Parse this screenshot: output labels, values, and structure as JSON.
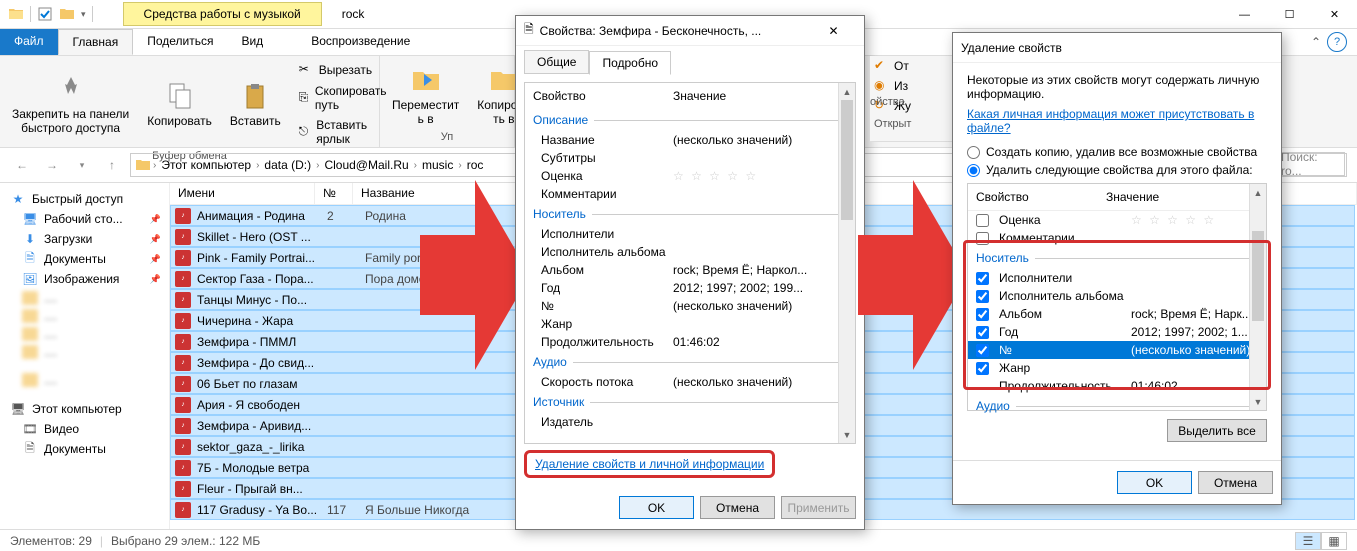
{
  "titlebar": {
    "music_tools": "Средства работы с музыкой",
    "folder": "rock"
  },
  "ribbon_tabs": {
    "file": "Файл",
    "home": "Главная",
    "share": "Поделиться",
    "view": "Вид",
    "playback": "Воспроизведение"
  },
  "ribbon": {
    "pin": "Закрепить на панели\nбыстрого доступа",
    "copy": "Копировать",
    "paste": "Вставить",
    "cut": "Вырезать",
    "copy_path": "Скопировать путь",
    "paste_shortcut": "Вставить ярлык",
    "clipboard_group": "Буфер обмена",
    "move_to": "Переместит\nь в",
    "copy_to": "Копирова\nть в",
    "org_group": "Уп",
    "open_group": "Открыт"
  },
  "breadcrumbs": [
    "Этот компьютер",
    "data (D:)",
    "Cloud@Mail.Ru",
    "music",
    "roc"
  ],
  "search_placeholder": "Поиск: ro...",
  "sidebar": {
    "quick": "Быстрый доступ",
    "desktop": "Рабочий сто...",
    "downloads": "Загрузки",
    "documents": "Документы",
    "pictures": "Изображения",
    "thispc": "Этот компьютер",
    "videos": "Видео",
    "documents2": "Документы"
  },
  "columns": {
    "name": "Имени",
    "num": "№",
    "title": "Название"
  },
  "files": [
    {
      "name": "Анимация - Родина",
      "num": "2",
      "title": "Родина"
    },
    {
      "name": "Skillet - Hero (OST ...",
      "num": "",
      "title": ""
    },
    {
      "name": "Pink - Family Portrai...",
      "num": "",
      "title": "Family portrait"
    },
    {
      "name": "Сектор Газа - Пора...",
      "num": "",
      "title": "Пора домой"
    },
    {
      "name": "Танцы Минус - По...",
      "num": "",
      "title": ""
    },
    {
      "name": "Чичерина - Жара",
      "num": "",
      "title": ""
    },
    {
      "name": "Земфира - ПММЛ",
      "num": "",
      "title": ""
    },
    {
      "name": "Земфира - До свид...",
      "num": "",
      "title": ""
    },
    {
      "name": "06 Бьет по глазам",
      "num": "",
      "title": ""
    },
    {
      "name": "Ария - Я свободен",
      "num": "",
      "title": ""
    },
    {
      "name": "Земфира - Аривид...",
      "num": "",
      "title": ""
    },
    {
      "name": "sektor_gaza_-_lirika",
      "num": "",
      "title": ""
    },
    {
      "name": "7Б - Молодые ветра",
      "num": "",
      "title": ""
    },
    {
      "name": "Fleur - Прыгай вн...",
      "num": "",
      "title": ""
    },
    {
      "name": "117 Gradusy - Ya Bo...",
      "num": "117",
      "title": "Я Больше Никогда"
    }
  ],
  "status": {
    "items": "Элементов: 29",
    "selected": "Выбрано 29 элем.: 122 МБ"
  },
  "dialog1": {
    "title": "Свойства: Земфира - Бесконечность, ...",
    "tab_general": "Общие",
    "tab_details": "Подробно",
    "hdr_prop": "Свойство",
    "hdr_val": "Значение",
    "groups": {
      "description": "Описание",
      "media": "Носитель",
      "audio": "Аудио",
      "source": "Источник"
    },
    "rows": {
      "title": "Название",
      "title_val": "(несколько значений)",
      "subtitles": "Субтитры",
      "rating": "Оценка",
      "comments": "Комментарии",
      "artists": "Исполнители",
      "album_artist": "Исполнитель альбома",
      "album": "Альбом",
      "album_val": "rock; Время Ё; Наркол...",
      "year": "Год",
      "year_val": "2012; 1997; 2002; 199...",
      "track": "№",
      "track_val": "(несколько значений)",
      "genre": "Жанр",
      "duration": "Продолжительность",
      "duration_val": "01:46:02",
      "bitrate": "Скорость потока",
      "bitrate_val": "(несколько значений)",
      "publisher": "Издатель"
    },
    "remove_link": "Удаление свойств и личной информации",
    "ok": "OK",
    "cancel": "Отмена",
    "apply": "Применить"
  },
  "peek": {
    "select": "От",
    "invert": "Из",
    "log": "Жу",
    "props": "ойства"
  },
  "dialog2": {
    "title": "Удаление свойств",
    "info": "Некоторые из этих свойств могут содержать личную информацию.",
    "link": "Какая личная информация может присутствовать в файле?",
    "radio1": "Создать копию, удалив все возможные свойства",
    "radio2": "Удалить следующие свойства для этого файла:",
    "hdr_prop": "Свойство",
    "hdr_val": "Значение",
    "rows": {
      "rating": "Оценка",
      "comments": "Комментарии",
      "group_media": "Носитель",
      "artists": "Исполнители",
      "album_artist": "Исполнитель альбома",
      "album": "Альбом",
      "album_val": "rock; Время Ё; Нарк...",
      "year": "Год",
      "year_val": "2012; 1997; 2002; 1...",
      "track": "№",
      "track_val": "(несколько значений)",
      "genre": "Жанр",
      "duration": "Продолжительность",
      "duration_val": "01:46:02",
      "group_audio": "Аудио"
    },
    "select_all": "Выделить все",
    "ok": "OK",
    "cancel": "Отмена"
  }
}
